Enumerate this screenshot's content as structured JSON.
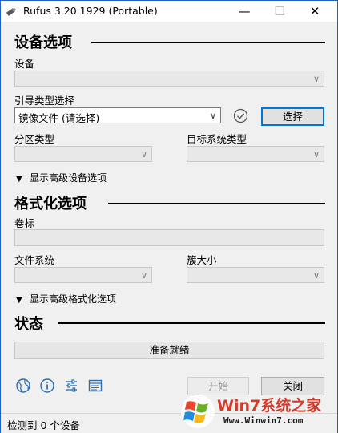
{
  "window": {
    "title": "Rufus 3.20.1929 (Portable)",
    "minimize_glyph": "—",
    "maximize_glyph": "☐",
    "close_glyph": "✕"
  },
  "device_section": {
    "heading": "设备选项",
    "device_label": "设备",
    "device_value": "",
    "boot_label": "引导类型选择",
    "boot_value": "镜像文件 (请选择)",
    "select_button": "选择",
    "partition_label": "分区类型",
    "target_label": "目标系统类型",
    "advanced_toggle": "显示高级设备选项"
  },
  "format_section": {
    "heading": "格式化选项",
    "volume_label": "卷标",
    "volume_value": "",
    "fs_label": "文件系统",
    "cluster_label": "簇大小",
    "advanced_toggle": "显示高级格式化选项"
  },
  "status_section": {
    "heading": "状态",
    "status_text": "准备就绪"
  },
  "actions": {
    "start_button": "开始",
    "close_button": "关闭"
  },
  "toolbar_icons": [
    "globe-icon",
    "info-icon",
    "settings-sliders-icon",
    "log-icon"
  ],
  "footer": {
    "status": "检测到 0 个设备"
  },
  "watermark": {
    "brand": "Win7系统之家",
    "url": "Www.Winwin7.com"
  },
  "colors": {
    "focus_border": "#0078d7",
    "icon_blue": "#2a6fb5",
    "window_border": "#1f5fbf",
    "watermark_red": "#d23b2a"
  }
}
